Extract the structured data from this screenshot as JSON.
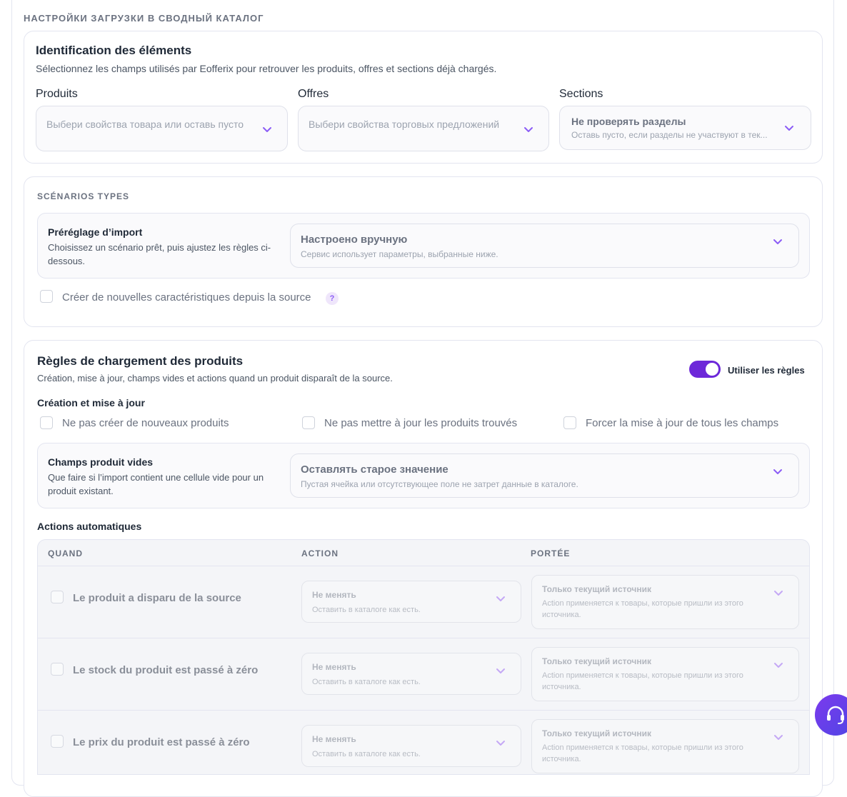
{
  "header": {
    "title": "НАСТРОЙКИ ЗАГРУЗКИ В СВОДНЫЙ КАТАЛОГ"
  },
  "identification": {
    "title": "Identification des éléments",
    "subtitle": "Sélectionnez les champs utilisés par Eofferix pour retrouver les produits, offres et sections déjà chargés.",
    "products": {
      "label": "Produits",
      "placeholder": "Выбери свойства товара или оставь пусто"
    },
    "offers": {
      "label": "Offres",
      "placeholder": "Выбери свойства торговых предложений"
    },
    "sections": {
      "label": "Sections",
      "value": "Не проверять разделы",
      "hint": "Оставь пусто, если разделы не участвуют в тек..."
    }
  },
  "scenarios": {
    "caption": "SCÉNARIOS TYPES",
    "preset": {
      "title": "Préréglage d’import",
      "description": "Choisissez un scénario prêt, puis ajustez les règles ci-dessous.",
      "value": "Настроено вручную",
      "hint": "Сервис использует параметры, выбранные ниже."
    },
    "create_characteristics": {
      "label": "Créer de nouvelles caractéristiques depuis la source",
      "help": "?"
    }
  },
  "rules": {
    "title": "Règles de chargement des produits",
    "subtitle": "Création, mise à jour, champs vides et actions quand un produit disparaît de la source.",
    "toggle_label": "Utiliser les règles",
    "toggle_on": true,
    "creation_heading": "Création et mise à jour",
    "checkboxes": [
      {
        "label": "Ne pas créer de nouveaux produits"
      },
      {
        "label": "Ne pas mettre à jour les produits trouvés"
      },
      {
        "label": "Forcer la mise à jour de tous les champs"
      }
    ],
    "empty_fields": {
      "title": "Champs produit vides",
      "description": "Que faire si l’import contient une cellule vide pour un produit existant.",
      "value": "Оставлять старое значение",
      "hint": "Пустая ячейка или отсутствующее поле не затрет данные в каталоге."
    },
    "auto_heading": "Actions automatiques",
    "table": {
      "columns": [
        "QUAND",
        "ACTION",
        "PORTÉE"
      ],
      "rows": [
        {
          "when": "Le produit a disparu de la source",
          "action": "Не менять",
          "action_hint": "Оставить в каталоге как есть.",
          "scope": "Только текущий источник",
          "scope_hint": "Action применяется к товары, которые пришли из этого источника."
        },
        {
          "when": "Le stock du produit est passé à zéro",
          "action": "Не менять",
          "action_hint": "Оставить в каталоге как есть.",
          "scope": "Только текущий источник",
          "scope_hint": "Action применяется к товары, которые пришли из этого источника."
        },
        {
          "when": "Le prix du produit est passé à zéro",
          "action": "Не менять",
          "action_hint": "Оставить в каталоге как есть.",
          "scope": "Только текущий источник",
          "scope_hint": "Action применяется к товары, которые пришли из этого источника."
        }
      ]
    }
  },
  "icons": {
    "chevron": "chevron-down-icon",
    "support": "headset-icon"
  },
  "colors": {
    "accent": "#6d28d9",
    "chevron": "#8b5cf6"
  }
}
